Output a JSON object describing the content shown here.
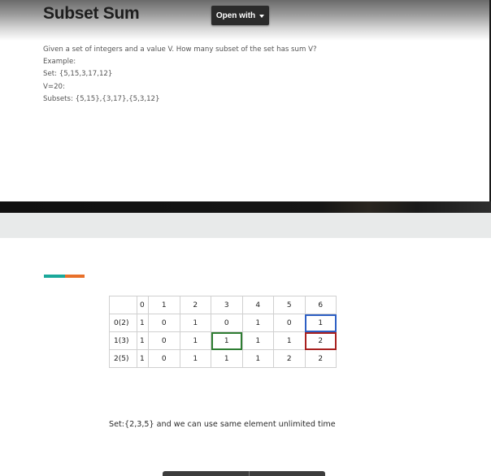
{
  "slide1": {
    "title": "Subset Sum",
    "open_with": {
      "label": "Open with"
    },
    "description": [
      "Given a set of integers and a value V. How many subset of the set has sum V?",
      "Example:",
      "Set: {5,15,3,17,12}",
      "V=20:",
      "Subsets: {5,15},{3,17},{5,3,12}"
    ]
  },
  "slide2": {
    "table": {
      "header": [
        "0",
        "1",
        "2",
        "3",
        "4",
        "5",
        "6"
      ],
      "rows": [
        {
          "label": "0(2)",
          "cells": [
            "1",
            "0",
            "1",
            "0",
            "1",
            "0",
            "1"
          ]
        },
        {
          "label": "1(3)",
          "cells": [
            "1",
            "0",
            "1",
            "1",
            "1",
            "1",
            "2"
          ]
        },
        {
          "label": "2(5)",
          "cells": [
            "1",
            "0",
            "1",
            "1",
            "1",
            "2",
            "2"
          ]
        }
      ]
    },
    "note": "Set:{2,3,5} and we can use same element unlimited time",
    "colors": {
      "accent_teal": "#1aa89a",
      "accent_orange": "#e8702a",
      "highlight_blue": "#2d5fc4",
      "highlight_red": "#a8201f",
      "highlight_green": "#2e7d32"
    }
  }
}
